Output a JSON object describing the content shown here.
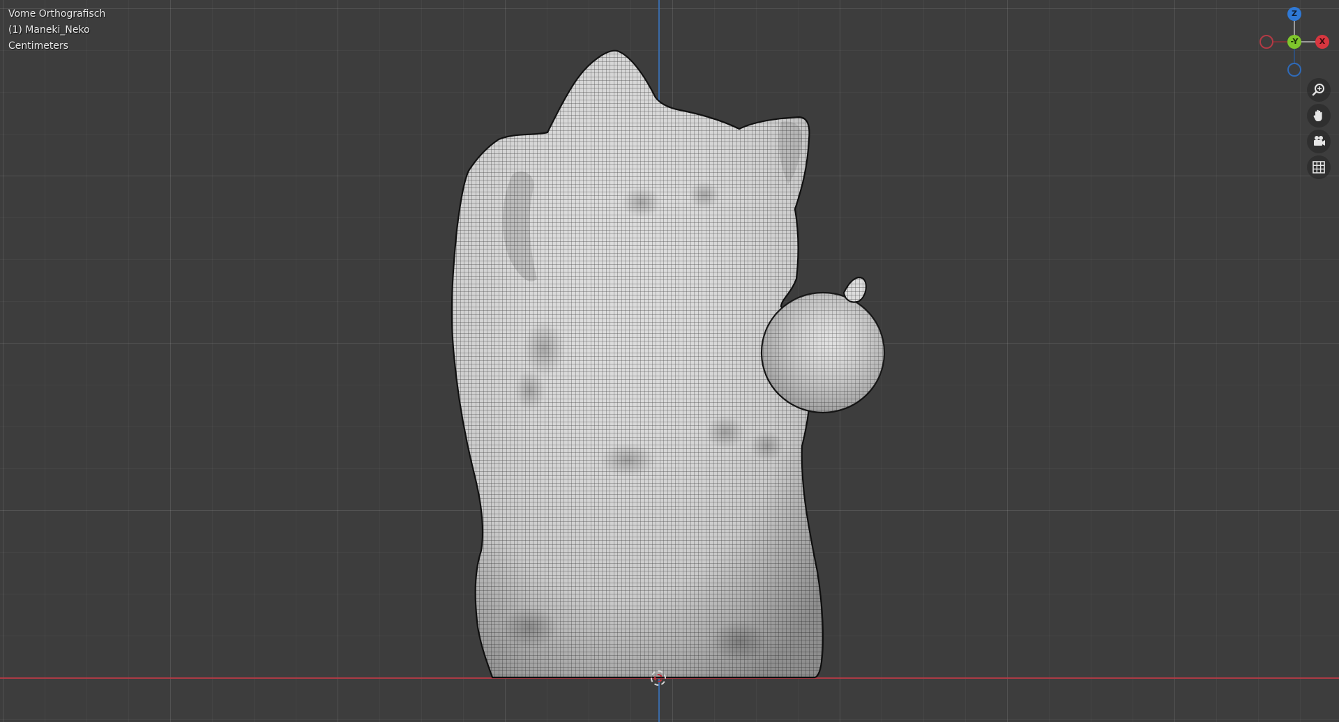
{
  "viewport": {
    "view_name": "Vome Orthografisch",
    "object_name": "(1) Maneki_Neko",
    "units": "Centimeters"
  },
  "gizmo": {
    "z_label": "Z",
    "x_label": "X",
    "y_label": "-Y",
    "colors": {
      "x": "#d8363f",
      "y": "#7fc72c",
      "z": "#2f79d6"
    }
  },
  "tools": [
    {
      "name": "zoom",
      "icon": "zoom-in-icon"
    },
    {
      "name": "pan",
      "icon": "hand-icon"
    },
    {
      "name": "camera",
      "icon": "camera-icon"
    },
    {
      "name": "ortho-toggle",
      "icon": "grid-icon"
    }
  ]
}
